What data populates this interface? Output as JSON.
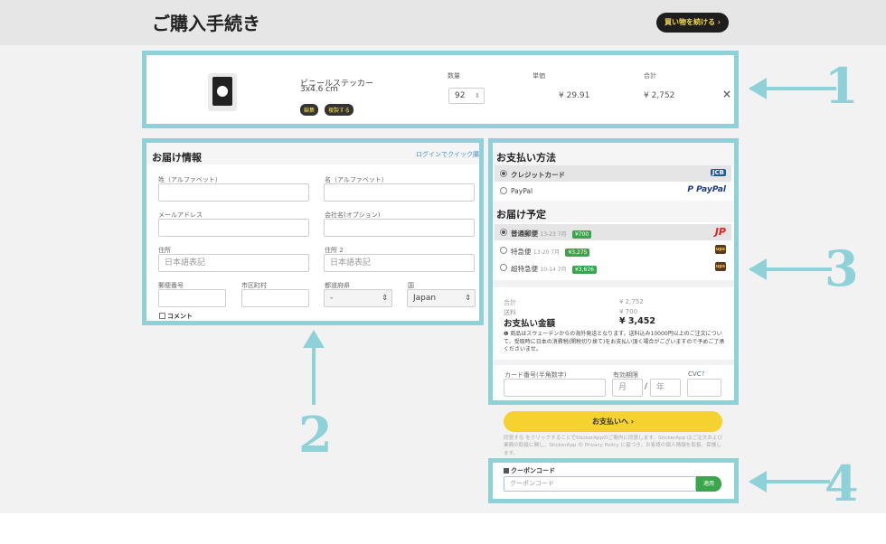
{
  "header": {
    "title": "ご購入手続き",
    "continue_label": "買い物を続ける ›"
  },
  "cart": {
    "product_name": "ビニールステッカー",
    "product_size": "3x4.6 cm",
    "edit_label": "編集",
    "duplicate_label": "複製する",
    "qty_header": "数量",
    "unit_header": "単価",
    "total_header": "合計",
    "qty_value": "92",
    "unit_price": "¥ 29.91",
    "total_price": "¥ 2,752",
    "remove_icon": "×"
  },
  "shipping": {
    "title": "お届け情報",
    "login_link": "ログインでクイック購入",
    "last_name_label": "姓（アルファベット）",
    "first_name_label": "名（アルファベット）",
    "email_label": "メールアドレス",
    "company_label": "会社名(オプション)",
    "address_label": "住所",
    "address2_label": "住所 2",
    "address_placeholder": "日本語表記",
    "address2_placeholder": "日本語表記",
    "zip_label": "郵便番号",
    "city_label": "市区町村",
    "pref_label": "都道府県",
    "country_label": "国",
    "pref_value": "-",
    "country_value": "Japan",
    "comment_label": "コメント"
  },
  "payment": {
    "title": "お支払い方法",
    "card_label": "クレジットカード",
    "paypal_label": "PayPal",
    "jcb_text": "JCB",
    "paypal_logo": "P PayPal",
    "delivery_title": "お届け予定",
    "options": [
      {
        "name": "普通郵便",
        "days": "13-23 7月",
        "price": "¥700",
        "logo": "JP"
      },
      {
        "name": "特急便",
        "days": "13-20 7月",
        "price": "¥3,275",
        "logo": "ups"
      },
      {
        "name": "超特急便",
        "days": "10-14 7月",
        "price": "¥3,626",
        "logo": "ups"
      }
    ],
    "subtotal_label": "合計",
    "subtotal_value": "¥ 2,752",
    "shipping_label": "送料",
    "shipping_value": "¥ 700",
    "total_label": "お支払い金額",
    "total_value": "¥ 3,452",
    "notice": "❶ 商品はスウェーデンからの海外発送となります。送料込み10000円以上のご注文について、受取時に日本の消費税(関税切り捨て)をお支払い頂く場合がございますので予めご了承くださいませ。",
    "card_number_label": "カード番号(半角数字)",
    "expiry_label": "有効期限",
    "cvc_label": "CVC",
    "cvc_help": "?",
    "month_placeholder": "月",
    "year_placeholder": "年",
    "slash": "/"
  },
  "checkout": {
    "pay_label": "お支払いへ ›",
    "terms": "同意する をクリックすることでStickerAppのご案内に同意します。StickerApp はご注文および業務の取扱に関し、StickerApp の Privacy Policy に基づき、お客様の個人情報を取扱、保護します。"
  },
  "coupon": {
    "label": "クーポンコード",
    "placeholder": "クーポンコード",
    "apply_label": "適用"
  },
  "annotations": {
    "n1": "1",
    "n2": "2",
    "n3": "3",
    "n4": "4"
  },
  "colors": {
    "highlight": "#8fd1d8",
    "pay_button": "#f5d230",
    "apply_button": "#3aa54a"
  }
}
